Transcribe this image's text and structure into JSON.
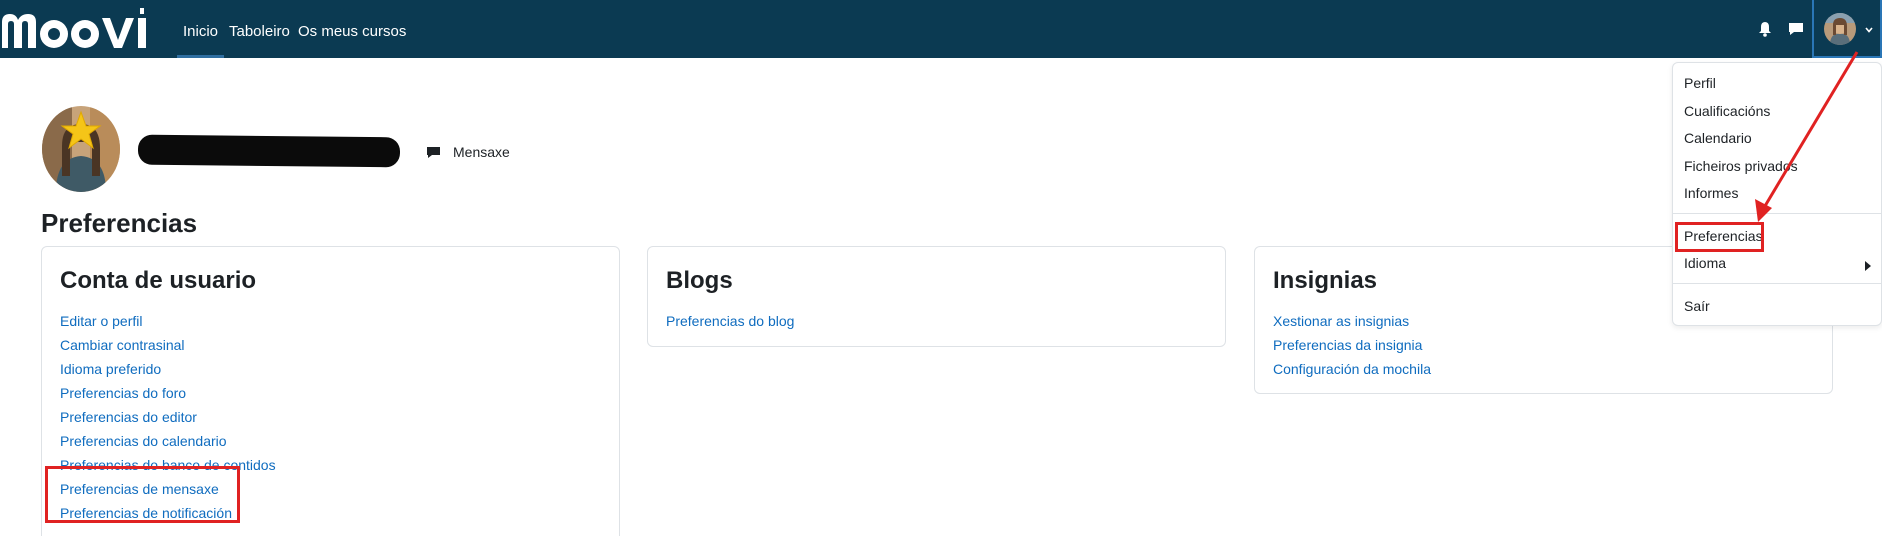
{
  "navbar": {
    "logo_text": "moovi",
    "links": [
      {
        "label": "Inicio",
        "active": true
      },
      {
        "label": "Taboleiro"
      },
      {
        "label": "Os meus cursos"
      }
    ],
    "icons": [
      "bell-icon",
      "chat-icon",
      "user-avatar",
      "chevron-down-icon"
    ],
    "bg_color": "#0b3a52"
  },
  "profile": {
    "message_label": "Mensaxe"
  },
  "page_title": "Preferencias",
  "cards": [
    {
      "title": "Conta de usuario",
      "links": [
        "Editar o perfil",
        "Cambiar contrasinal",
        "Idioma preferido",
        "Preferencias do foro",
        "Preferencias do editor",
        "Preferencias do calendario",
        "Preferencias do banco de contidos",
        "Preferencias de mensaxe",
        "Preferencias de notificación"
      ]
    },
    {
      "title": "Blogs",
      "links": [
        "Preferencias do blog"
      ]
    },
    {
      "title": "Insignias",
      "links": [
        "Xestionar as insignias",
        "Preferencias da insignia",
        "Configuración da mochila"
      ]
    }
  ],
  "user_menu": {
    "items": [
      "Perfil",
      "Cualificacións",
      "Calendario",
      "Ficheiros privados",
      "Informes",
      "Preferencias",
      "Idioma",
      "Saír"
    ]
  },
  "colors": {
    "link": "#0f6cbf",
    "annotation": "#e02222"
  }
}
